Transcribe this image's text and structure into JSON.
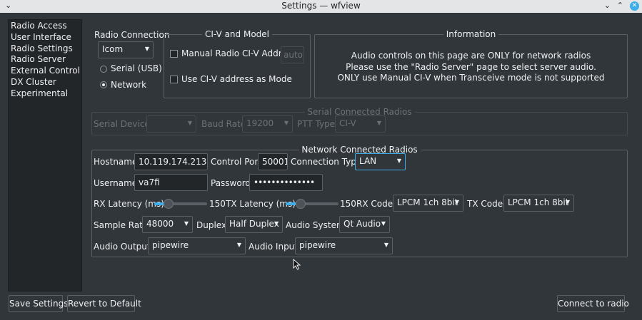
{
  "window": {
    "title": "Settings — wfview",
    "minimize_icon": "chevron-down-icon",
    "close_icon": "close-icon"
  },
  "sidebar": {
    "items": [
      "Radio Access",
      "User Interface",
      "Radio Settings",
      "Radio Server",
      "External Control",
      "DX Cluster",
      "Experimental"
    ]
  },
  "radio_connection": {
    "title": "Radio Connection",
    "radio_type": "Icom",
    "serial_label": "Serial (USB)",
    "network_label": "Network",
    "selected": "Network"
  },
  "civ": {
    "title": "CI-V and Model",
    "manual_label": "Manual Radio CI-V Addres",
    "manual_value": "auto",
    "use_civ_label": "Use CI-V address as Mode"
  },
  "information": {
    "title": "Information",
    "lines": [
      "Audio controls on this page are ONLY for network radios",
      "Please use the \"Radio Server\" page to select server audio.",
      "ONLY use Manual CI-V when Transceive mode is not supported"
    ]
  },
  "serial": {
    "title": "Serial Connected Radios",
    "device_label": "Serial Device:",
    "device_value": "",
    "baud_label": "Baud Rate",
    "baud_value": "19200",
    "ptt_label": "PTT Type:",
    "ptt_value": "CI-V"
  },
  "network": {
    "title": "Network Connected Radios",
    "hostname_label": "Hostname",
    "hostname": "10.119.174.213",
    "control_port_label": "Control Port",
    "control_port": "50001",
    "connection_type_label": "Connection Type",
    "connection_type": "LAN",
    "username_label": "Username",
    "username": "va7fi",
    "password_label": "Password",
    "password": "••••••••••••••",
    "rx_latency_label": "RX Latency (ms)",
    "rx_latency": "150",
    "tx_latency_label": "TX Latency (ms)",
    "tx_latency": "150",
    "rx_codec_label": "RX Codec",
    "rx_codec": "LPCM 1ch 8bit",
    "tx_codec_label": "TX Codec",
    "tx_codec": "LPCM 1ch 8bit",
    "sample_rate_label": "Sample Rate",
    "sample_rate": "48000",
    "duplex_label": "Duplex",
    "duplex": "Half Duplex",
    "audio_system_label": "Audio System",
    "audio_system": "Qt Audio",
    "audio_output_label": "Audio Output",
    "audio_output": "pipewire",
    "audio_input_label": "Audio Input",
    "audio_input": "pipewire"
  },
  "buttons": {
    "save": "Save Settings",
    "revert": "Revert to Default",
    "connect": "Connect to radio"
  },
  "colors": {
    "background": "#31363b",
    "accent": "#3daee9",
    "field": "#232629"
  }
}
